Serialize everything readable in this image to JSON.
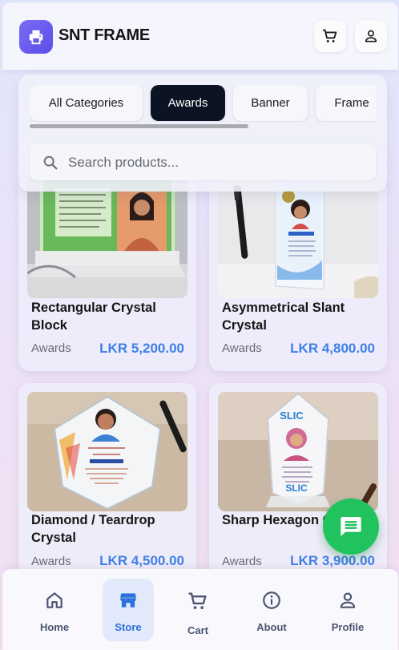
{
  "header": {
    "brand": "SNT FRAME",
    "logo_icon": "printer-icon",
    "cart_icon": "cart-icon",
    "profile_icon": "user-icon"
  },
  "categories": {
    "items": [
      "All Categories",
      "Awards",
      "Banner",
      "Frame"
    ],
    "active": "Awards"
  },
  "search": {
    "placeholder": "Search products..."
  },
  "products": [
    {
      "name": "Rectangular Crystal Block",
      "category": "Awards",
      "price": "LKR 5,200.00"
    },
    {
      "name": "Asymmetrical Slant Crystal",
      "category": "Awards",
      "price": "LKR 4,800.00"
    },
    {
      "name": "Diamond / Teardrop Crystal",
      "category": "Awards",
      "price": "LKR 4,500.00"
    },
    {
      "name": "Sharp Hexagon Crystal",
      "category": "Awards",
      "price": "LKR 3,900.00"
    }
  ],
  "nav": {
    "items": [
      "Home",
      "Store",
      "Cart",
      "About",
      "Profile"
    ],
    "active": "Store"
  },
  "colors": {
    "accent": "#3f7fe8",
    "active_chip": "#0c1424",
    "fab": "#21c35f",
    "logo": "#6a5cf0"
  },
  "fab_icon": "chat-icon"
}
